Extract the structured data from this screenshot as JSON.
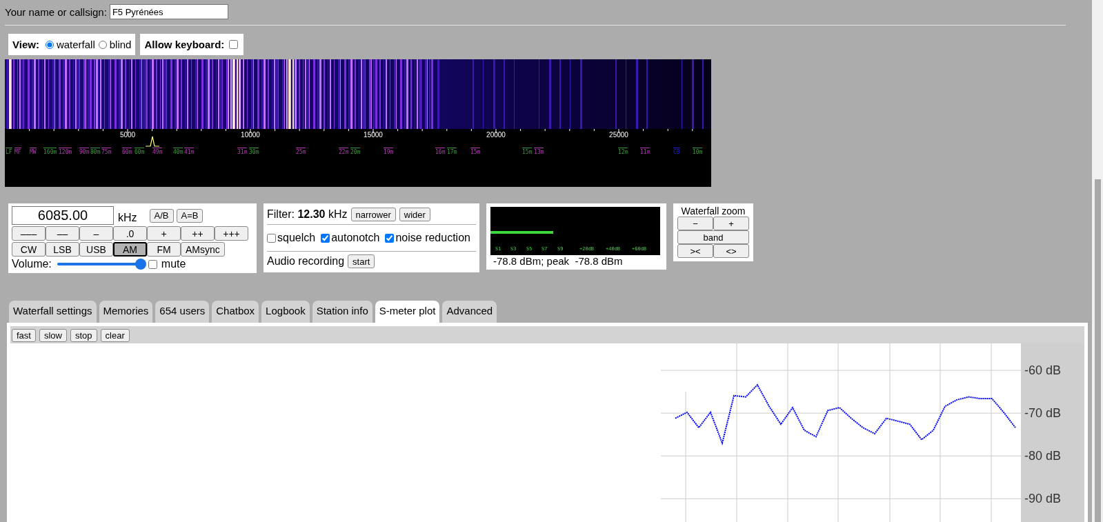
{
  "callsign": {
    "label": "Your name or callsign:",
    "value": "F5 Pyrénées"
  },
  "view": {
    "label": "View:",
    "options": [
      {
        "label": "waterfall",
        "selected": true
      },
      {
        "label": "blind",
        "selected": false
      }
    ]
  },
  "keyboard": {
    "label": "Allow keyboard:",
    "checked": false
  },
  "scale": {
    "ticks": [
      "5000",
      "10000",
      "15000",
      "20000",
      "25000"
    ],
    "bands": [
      {
        "label": "LF",
        "color": "#3c9a3c"
      },
      {
        "label": "MF",
        "color": "#b23cb2"
      },
      {
        "label": "MW",
        "color": "#b23cb2"
      },
      {
        "label": "160m",
        "color": "#3c9a3c"
      },
      {
        "label": "120m",
        "color": "#b23cb2"
      },
      {
        "label": "90m",
        "color": "#b23cb2"
      },
      {
        "label": "80m",
        "color": "#3c9a3c"
      },
      {
        "label": "75m",
        "color": "#b23cb2"
      },
      {
        "label": "60m",
        "color": "#b23cb2"
      },
      {
        "label": "60m",
        "color": "#3c9a3c"
      },
      {
        "label": "49m",
        "color": "#b23cb2"
      },
      {
        "label": "40m",
        "color": "#3c9a3c"
      },
      {
        "label": "41m",
        "color": "#b23cb2"
      },
      {
        "label": "31m",
        "color": "#b23cb2"
      },
      {
        "label": "30m",
        "color": "#3c9a3c"
      },
      {
        "label": "25m",
        "color": "#b23cb2"
      },
      {
        "label": "22m",
        "color": "#b23cb2"
      },
      {
        "label": "20m",
        "color": "#3c9a3c"
      },
      {
        "label": "19m",
        "color": "#b23cb2"
      },
      {
        "label": "16m",
        "color": "#b23cb2"
      },
      {
        "label": "17m",
        "color": "#3c9a3c"
      },
      {
        "label": "15m",
        "color": "#b23cb2"
      },
      {
        "label": "15m",
        "color": "#3c9a3c"
      },
      {
        "label": "13m",
        "color": "#b23cb2"
      },
      {
        "label": "12m",
        "color": "#3c9a3c"
      },
      {
        "label": "11m",
        "color": "#b23cb2"
      },
      {
        "label": "CB",
        "color": "#2020d0"
      },
      {
        "label": "10m",
        "color": "#3c9a3c"
      }
    ]
  },
  "tuning": {
    "frequency": "6085.00",
    "unit": "kHz",
    "buttons": [
      "A/B",
      "A=B"
    ],
    "steps": [
      "–––",
      "––",
      "–",
      ".0",
      "+",
      "++",
      "+++"
    ],
    "modes": [
      {
        "label": "CW",
        "selected": false
      },
      {
        "label": "LSB",
        "selected": false
      },
      {
        "label": "USB",
        "selected": false
      },
      {
        "label": "AM",
        "selected": true
      },
      {
        "label": "FM",
        "selected": false
      },
      {
        "label": "AMsync",
        "selected": false
      }
    ],
    "volume": {
      "label": "Volume:",
      "level": 0.95
    },
    "mute": {
      "label": "mute",
      "checked": false
    }
  },
  "filter": {
    "text": "Filter: **12.30** kHz",
    "buttons": [
      "narrower",
      "wider"
    ],
    "options": [
      {
        "label": "squelch",
        "checked": false
      },
      {
        "label": "autonotch",
        "checked": true
      },
      {
        "label": "noise reduction",
        "checked": true
      }
    ],
    "recording": {
      "label": "Audio recording",
      "button": "start"
    }
  },
  "smeter": {
    "level": 0.37,
    "scale": [
      "S1",
      "S3",
      "S5",
      "S7",
      "S9",
      "+20dB",
      "+40dB",
      "+60dB"
    ],
    "reading": "-78.8 dBm; peak  -78.8 dBm"
  },
  "waterfall_zoom": {
    "title": "Waterfall zoom",
    "buttons": [
      "−",
      "+",
      "band",
      "><",
      "<>"
    ]
  },
  "tabs": [
    {
      "label": "Waterfall settings",
      "selected": false
    },
    {
      "label": "Memories",
      "selected": false
    },
    {
      "label": "654 users",
      "selected": false
    },
    {
      "label": "Chatbox",
      "selected": false
    },
    {
      "label": "Logbook",
      "selected": false
    },
    {
      "label": "Station info",
      "selected": false
    },
    {
      "label": "S-meter plot",
      "selected": true
    },
    {
      "label": "Advanced",
      "selected": false
    }
  ],
  "plot": {
    "buttons": [
      "fast",
      "slow",
      "stop",
      "clear"
    ],
    "chart_data": {
      "type": "line",
      "grid": true,
      "ylim": [
        -95.6,
        -53.7
      ],
      "yticks": [
        {
          "value": -60,
          "label": "-60 dB"
        },
        {
          "value": -70,
          "label": "-70 dB"
        },
        {
          "value": -80,
          "label": "-80 dB"
        },
        {
          "value": -90,
          "label": "-90 dB"
        }
      ],
      "series": [
        {
          "color": "#0000ff",
          "line_style": "dashed",
          "values": [
            -71.2,
            -69.8,
            -73.4,
            -69.8,
            -77,
            -65.9,
            -66.2,
            -63.4,
            -68.4,
            -72.6,
            -68.7,
            -74,
            -75.5,
            -69.4,
            -68.7,
            -71.2,
            -73.4,
            -74.8,
            -71.2,
            -71.9,
            -72.6,
            -76.2,
            -74,
            -68.4,
            -66.9,
            -66.2,
            -66.6,
            -66.6,
            -69.8,
            -73.4
          ]
        }
      ]
    }
  }
}
